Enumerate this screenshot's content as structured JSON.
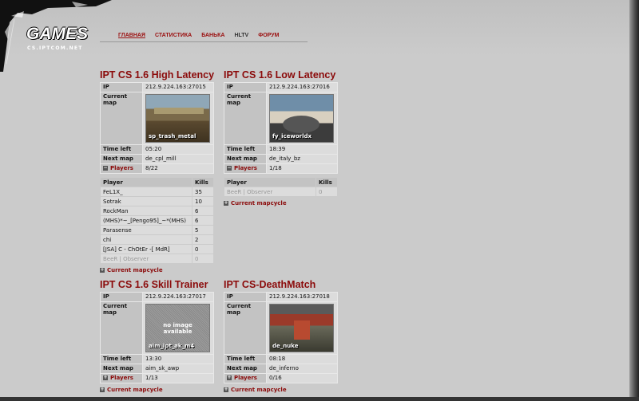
{
  "logo": {
    "title": "GAMES",
    "subtitle": "CS.IPTCOM.NET"
  },
  "nav": [
    "ГЛАВНАЯ",
    "СТАТИСТИКА",
    "БАНЬКА",
    "HLTV",
    "ФОРУМ"
  ],
  "labels": {
    "ip": "IP",
    "current_map": "Current map",
    "time_left": "Time left",
    "next_map": "Next map",
    "players": "Players",
    "player_col": "Player",
    "kills_col": "Kills",
    "mapcycle": "Current mapcycle",
    "no_image": "no image",
    "available": "available"
  },
  "servers": [
    {
      "title": "IPT CS 1.6 High Latency",
      "ip": "212.9.224.163:27015",
      "current_map": "sp_trash_metal",
      "time_left": "05:20",
      "next_map": "de_cpl_mill",
      "players": "8/22",
      "player_list": [
        {
          "name": "FeL1X_",
          "kills": "35"
        },
        {
          "name": "Sotrak",
          "kills": "10"
        },
        {
          "name": "RockMan",
          "kills": "6"
        },
        {
          "name": "(MHS)*~_[Pengo95]_~*(MHS)",
          "kills": "6"
        },
        {
          "name": "Parasense",
          "kills": "5"
        },
        {
          "name": "chi",
          "kills": "2"
        },
        {
          "name": "[JSA] C - ChOtEr -[ MdR]",
          "kills": "0"
        },
        {
          "name": "BeeR | Observer",
          "kills": "0"
        }
      ]
    },
    {
      "title": "IPT CS 1.6 Low Latency",
      "ip": "212.9.224.163:27016",
      "current_map": "fy_iceworldx",
      "time_left": "18:39",
      "next_map": "de_italy_bz",
      "players": "1/18",
      "player_list": [
        {
          "name": "BeeR | Observer",
          "kills": "0"
        }
      ]
    },
    {
      "title": "IPT CS 1.6 Skill Trainer",
      "ip": "212.9.224.163:27017",
      "current_map": "aim_ipt_ak_m4",
      "time_left": "13:30",
      "next_map": "aim_sk_awp",
      "players": "1/13"
    },
    {
      "title": "IPT CS-DeathMatch",
      "ip": "212.9.224.163:27018",
      "current_map": "de_nuke",
      "time_left": "08:18",
      "next_map": "de_inferno",
      "players": "0/16"
    }
  ]
}
